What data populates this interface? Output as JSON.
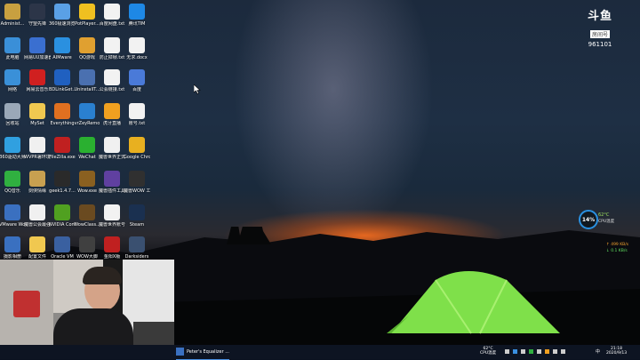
{
  "desktop": {
    "icons": [
      {
        "label": "Administ...",
        "color": "#c8a040"
      },
      {
        "label": "守望先锋",
        "color": "#2c3548"
      },
      {
        "label": "360极速浏览器",
        "color": "#5aa0e6"
      },
      {
        "label": "PotPlayer...",
        "color": "#f0c020"
      },
      {
        "label": "百度网盘.txt",
        "color": "#f2f2f2"
      },
      {
        "label": "腾讯TIM",
        "color": "#1e88e5"
      },
      {
        "label": "此电脑",
        "color": "#3a8fd8"
      },
      {
        "label": "网易UU加速器",
        "color": "#3a6fd0"
      },
      {
        "label": "AIMware",
        "color": "#2a90e0"
      },
      {
        "label": "QQ游戏",
        "color": "#e0a030"
      },
      {
        "label": "防止掉帧.txt",
        "color": "#f2f2f2"
      },
      {
        "label": "无求.docx",
        "color": "#f2f2f2"
      },
      {
        "label": "网络",
        "color": "#3a90d8"
      },
      {
        "label": "网易云音乐",
        "color": "#d02020"
      },
      {
        "label": "BDLinkGet...",
        "color": "#2060c0"
      },
      {
        "label": "UninstallT...",
        "color": "#4a70b0"
      },
      {
        "label": "公会链接.txt",
        "color": "#f2f2f2"
      },
      {
        "label": "百度",
        "color": "#4a7ad8"
      },
      {
        "label": "回收站",
        "color": "#9aa8b8"
      },
      {
        "label": "MySet",
        "color": "#f0c850"
      },
      {
        "label": "Everything",
        "color": "#e07020"
      },
      {
        "label": "vrZeyRemo",
        "color": "#2a80d0"
      },
      {
        "label": "虎牙直播",
        "color": "#f0a020"
      },
      {
        "label": "账号.txt",
        "color": "#f2f2f2"
      },
      {
        "label": "360驱动大师",
        "color": "#30a0e0"
      },
      {
        "label": "WVPR署环境v3.2.7绿色版",
        "color": "#f0f0f0"
      },
      {
        "label": "FileZilla.exe",
        "color": "#c02020"
      },
      {
        "label": "WeChat",
        "color": "#2ab030"
      },
      {
        "label": "魔兽世界正式服直装...",
        "color": "#f0f0f0"
      },
      {
        "label": "Google Chrome",
        "color": "#e8b020"
      },
      {
        "label": "QQ音乐",
        "color": "#30b040"
      },
      {
        "label": "剑侠情缘",
        "color": "#c8a050"
      },
      {
        "label": "geek1.4.7...",
        "color": "#2a2a2a"
      },
      {
        "label": "Wow.exe",
        "color": "#8a6020"
      },
      {
        "label": "魔兽插件工具6012.rar",
        "color": "#6040a0"
      },
      {
        "label": "魔兽WOW 工具RV3.2...",
        "color": "#303030"
      },
      {
        "label": "VMware Workstat...",
        "color": "#3a70c0"
      },
      {
        "label": "魔兽公会最强工具3612",
        "color": "#f0f0f0"
      },
      {
        "label": "NVIDIA Contr...",
        "color": "#50a020"
      },
      {
        "label": "WowClass...",
        "color": "#6a4a20"
      },
      {
        "label": "魔兽世界账号.txt",
        "color": "#f2f2f2"
      },
      {
        "label": "Steam",
        "color": "#1a3050"
      },
      {
        "label": "摄影相册",
        "color": "#3a70c0"
      },
      {
        "label": "配置文件",
        "color": "#f0c850"
      },
      {
        "label": "Oracle VM",
        "color": "#3a60a0"
      },
      {
        "label": "WOW大脚",
        "color": "#404040"
      },
      {
        "label": "金阳X版",
        "color": "#c02020"
      },
      {
        "label": "Darksiders",
        "color": "#3a5070"
      }
    ]
  },
  "watermark": {
    "logo": "斗鱼",
    "sub": "房间号",
    "room_id": "961101"
  },
  "widget": {
    "percent": "14%",
    "temp": "62°C",
    "usage_label": "CPU温度"
  },
  "network": {
    "up": "↑ 499 KB/s",
    "down": "↓ 0.1 KB/s"
  },
  "taskbar": {
    "active_app": "Peter's Equalizer ...",
    "cpu_temp": "62°C",
    "cpu_label": "CPU温度",
    "time": "21:18",
    "date": "2020/9/13",
    "lang": "中"
  }
}
